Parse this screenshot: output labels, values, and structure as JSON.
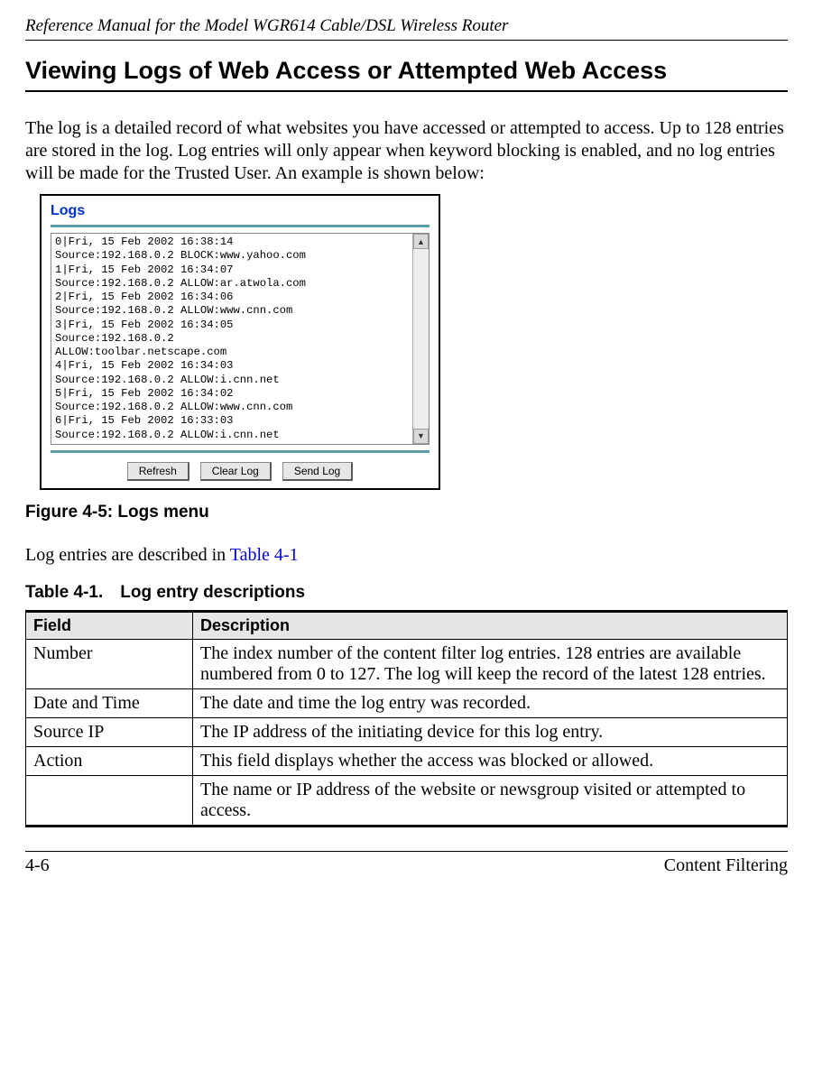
{
  "header": {
    "running_title": "Reference Manual for the Model WGR614 Cable/DSL Wireless Router"
  },
  "section": {
    "title": "Viewing Logs of Web Access or Attempted Web Access",
    "intro": "The log is a detailed record of what websites you have accessed or attempted to access. Up to 128 entries are stored in the log. Log entries will only appear when keyword blocking is enabled, and no log entries will be made for the Trusted User. An example is shown below:"
  },
  "screenshot": {
    "panel_title": "Logs",
    "log_lines": "0|Fri, 15 Feb 2002 16:38:14\nSource:192.168.0.2 BLOCK:www.yahoo.com\n1|Fri, 15 Feb 2002 16:34:07\nSource:192.168.0.2 ALLOW:ar.atwola.com\n2|Fri, 15 Feb 2002 16:34:06\nSource:192.168.0.2 ALLOW:www.cnn.com\n3|Fri, 15 Feb 2002 16:34:05\nSource:192.168.0.2\nALLOW:toolbar.netscape.com\n4|Fri, 15 Feb 2002 16:34:03\nSource:192.168.0.2 ALLOW:i.cnn.net\n5|Fri, 15 Feb 2002 16:34:02\nSource:192.168.0.2 ALLOW:www.cnn.com\n6|Fri, 15 Feb 2002 16:33:03\nSource:192.168.0.2 ALLOW:i.cnn.net",
    "buttons": {
      "refresh": "Refresh",
      "clear": "Clear Log",
      "send": "Send Log"
    }
  },
  "figure": {
    "caption": "Figure 4-5: Logs menu"
  },
  "para2": {
    "text_before": "Log entries are described in ",
    "link_text": "Table 4-1"
  },
  "table": {
    "caption": "Table 4-1. Log entry descriptions",
    "headers": {
      "field": "Field",
      "desc": "Description"
    },
    "rows": [
      {
        "field": "Number",
        "desc": "The index number of the content filter log entries. 128 entries are available numbered from 0 to 127. The log will keep the record of the latest 128 entries."
      },
      {
        "field": "Date and Time",
        "desc": "The date and time the log entry was recorded."
      },
      {
        "field": "Source IP",
        "desc": "The IP address of the initiating device for this log entry."
      },
      {
        "field": "Action",
        "desc": "This field displays whether the access was blocked or allowed."
      },
      {
        "field": "",
        "desc": "The name or IP address of the website or newsgroup visited or attempted to access."
      }
    ]
  },
  "footer": {
    "left": "4-6",
    "right": "Content Filtering"
  }
}
